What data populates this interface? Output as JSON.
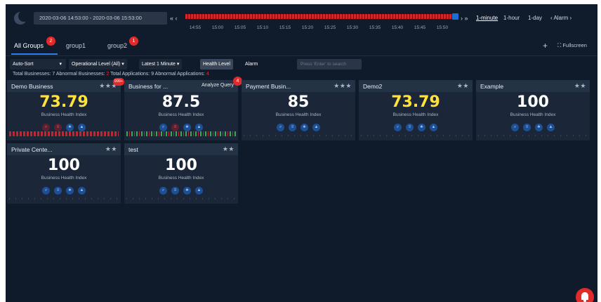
{
  "topbar": {
    "time_range": "2020-03-06 14:53:00 - 2020-03-06 15:53:00",
    "nav_prev": "« ‹",
    "nav_next": "› »",
    "ticks": [
      "14:55",
      "15:00",
      "15:05",
      "15:10",
      "15:15",
      "15:20",
      "15:25",
      "15:30",
      "15:35",
      "15:40",
      "15:45",
      "15:50"
    ],
    "granularity": [
      "1-minute",
      "1-hour",
      "1-day"
    ],
    "active_granularity": "1-minute",
    "alarm_label": "‹ Alarm ›"
  },
  "tabs": {
    "items": [
      {
        "label": "All Groups",
        "badge": "2",
        "active": true
      },
      {
        "label": "group1",
        "badge": "",
        "active": false
      },
      {
        "label": "group2",
        "badge": "1",
        "active": false
      }
    ],
    "add_label": "+",
    "fullscreen_label": "⛶ Fullscreen"
  },
  "filters": {
    "sort": "Auto-Sort",
    "operational_level": "Operational Level (All)",
    "latest": "Latest 1 Minute",
    "health_level": "Health Level",
    "alarm": "Alarm",
    "search_placeholder": "Press 'Enter' to search"
  },
  "summary": {
    "total_businesses_label": "Total Businesses: 7",
    "abnormal_businesses_label": "Abnormal Businesses:",
    "abnormal_businesses_value": "2",
    "total_applications_label": "Total Applications: 9",
    "abnormal_applications_label": "Abnormal Applications:",
    "abnormal_applications_value": "4"
  },
  "cards": [
    {
      "title": "Demo Business",
      "stars": "★★★",
      "value": "73.79",
      "sub": "Business Health Index",
      "color": "#ffe23a"
    },
    {
      "title": "Business for ...",
      "stars": "",
      "value": "87.5",
      "sub": "Business Health Index",
      "color": "#ffffff",
      "action": "Analyze Query"
    },
    {
      "title": "Payment Busin...",
      "stars": "★★★",
      "value": "85",
      "sub": "Business Health Index",
      "color": "#ffffff"
    },
    {
      "title": "Demo2",
      "stars": "★★",
      "value": "73.79",
      "sub": "Business Health Index",
      "color": "#ffe23a"
    },
    {
      "title": "Example",
      "stars": "★★",
      "value": "100",
      "sub": "Business Health Index",
      "color": "#ffffff"
    },
    {
      "title": "Private Cente...",
      "stars": "★★",
      "value": "100",
      "sub": "Business Health Index",
      "color": "#ffffff"
    },
    {
      "title": "test",
      "stars": "★★",
      "value": "100",
      "sub": "Business Health Index",
      "color": "#ffffff"
    }
  ],
  "callouts": {
    "card1_tag": "999+",
    "card2_badge": "4"
  },
  "colors": {
    "background": "#0f1a2b",
    "card": "#1b2738",
    "alarm_red": "#e12b2b",
    "health_yellow": "#ffe23a",
    "accent_blue": "#2d7ff0"
  }
}
